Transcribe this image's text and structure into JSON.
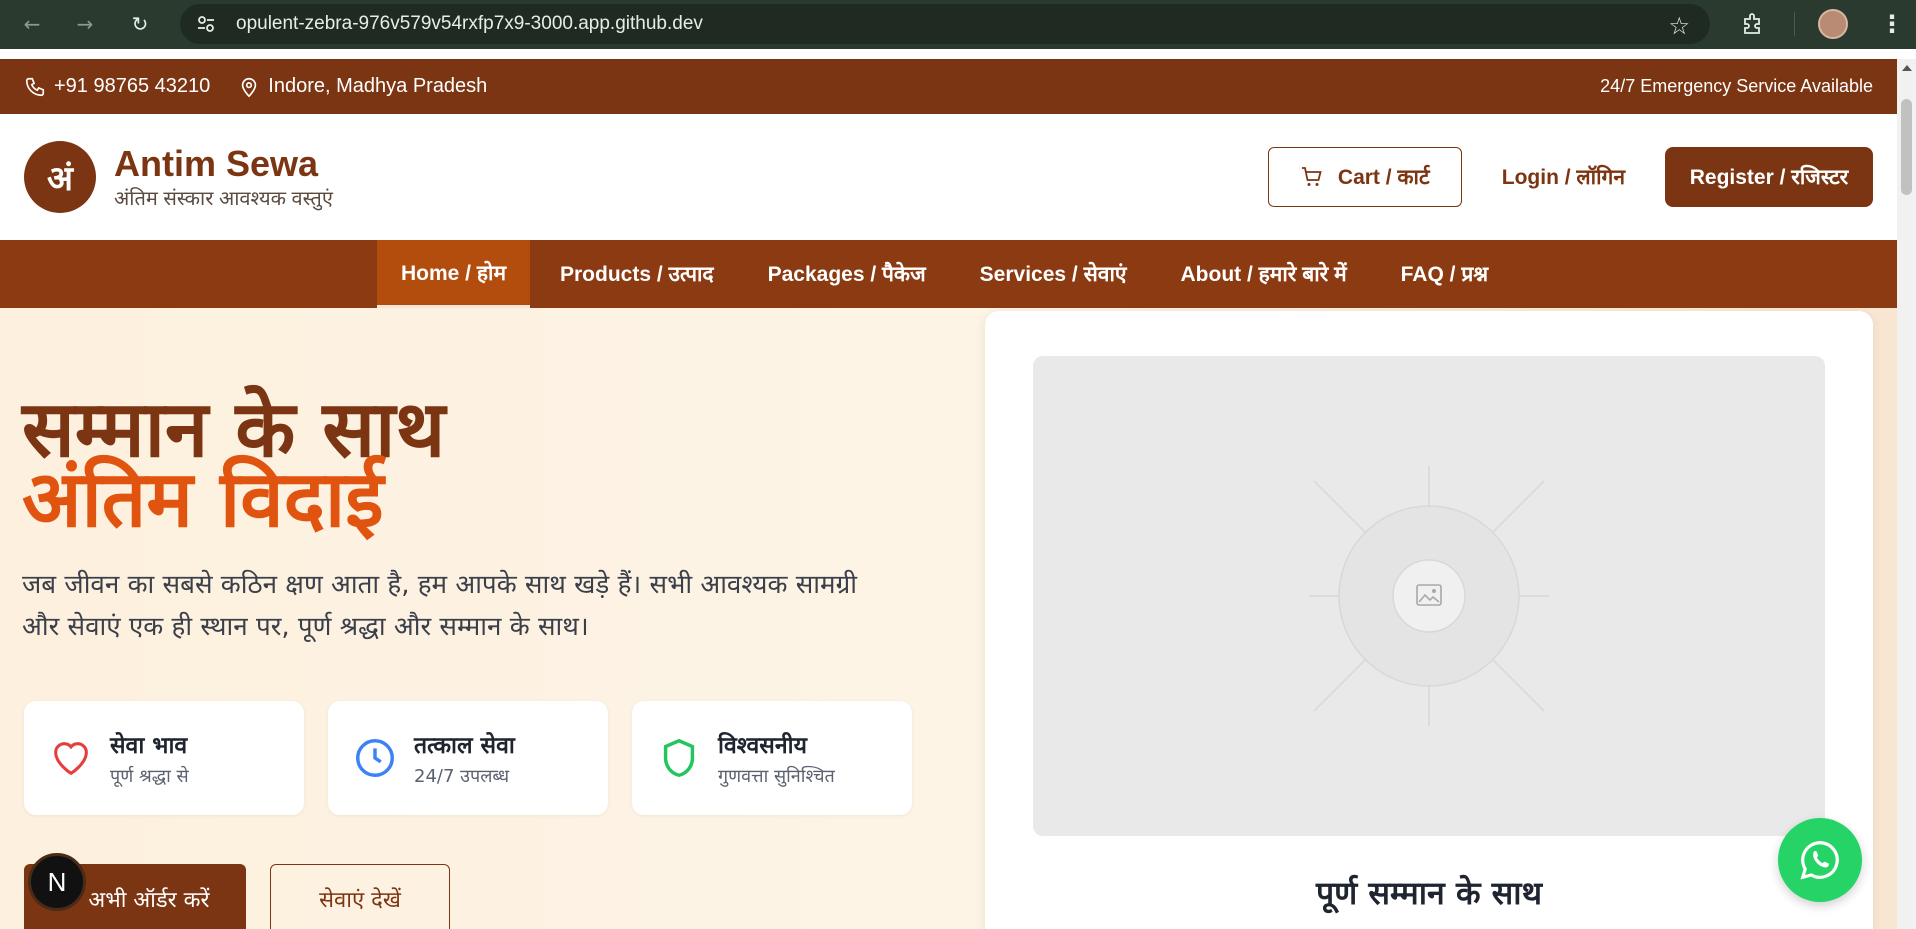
{
  "browser": {
    "url": "opulent-zebra-976v579v54rxfp7x9-3000.app.github.dev"
  },
  "topbar": {
    "phone": "+91 98765 43210",
    "location": "Indore, Madhya Pradesh",
    "emergency": "24/7 Emergency Service Available"
  },
  "header": {
    "logo_letter": "अं",
    "brand_name": "Antim Sewa",
    "brand_tagline": "अंतिम संस्कार आवश्यक वस्तुएं",
    "cart_label": "Cart / कार्ट",
    "login_label": "Login / लॉगिन",
    "register_label": "Register / रजिस्टर"
  },
  "nav": {
    "items": [
      {
        "label": "Home / होम",
        "active": true
      },
      {
        "label": "Products / उत्पाद"
      },
      {
        "label": "Packages / पैकेज"
      },
      {
        "label": "Services / सेवाएं"
      },
      {
        "label": "About / हमारे बारे में"
      },
      {
        "label": "FAQ / प्रश्न"
      }
    ]
  },
  "hero": {
    "title_line1": "सम्मान के साथ",
    "title_line2": "अंतिम विदाई",
    "description": "जब जीवन का सबसे कठिन क्षण आता है, हम आपके साथ खड़े हैं। सभी आवश्यक सामग्री और सेवाएं एक ही स्थान पर, पूर्ण श्रद्धा और सम्मान के साथ।",
    "features": [
      {
        "title": "सेवा भाव",
        "subtitle": "पूर्ण श्रद्धा से",
        "icon": "heart-icon",
        "color": "#e53e3e"
      },
      {
        "title": "तत्काल सेवा",
        "subtitle": "24/7 उपलब्ध",
        "icon": "clock-icon",
        "color": "#3b82f6"
      },
      {
        "title": "विश्वसनीय",
        "subtitle": "गुणवत्ता सुनिश्चित",
        "icon": "shield-icon",
        "color": "#22c55e"
      }
    ],
    "primary_button": "अभी ऑर्डर करें",
    "secondary_button": "सेवाएं देखें",
    "card_caption": "पूर्ण सम्मान के साथ"
  },
  "dev_badge": "N",
  "colors": {
    "brand": "#7c3512",
    "accent": "#e0540f",
    "nav": "#8b3a12",
    "whatsapp": "#25d366"
  }
}
